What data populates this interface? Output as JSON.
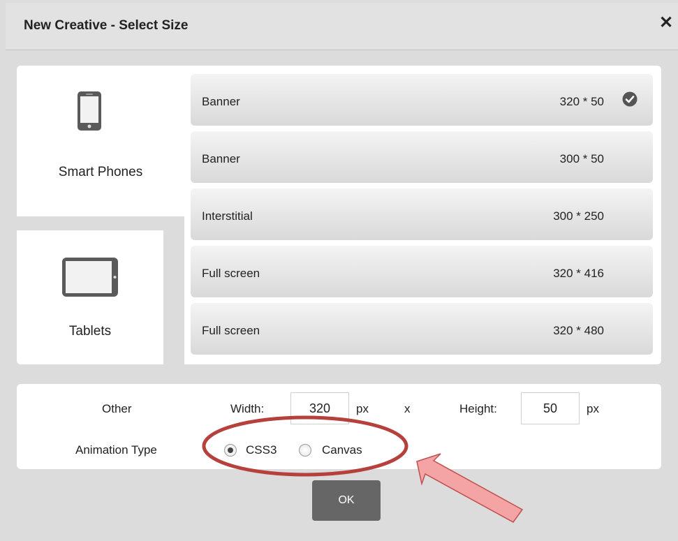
{
  "dialog": {
    "title": "New Creative - Select Size",
    "close_label": "✕"
  },
  "devices": [
    {
      "label": "Smart Phones",
      "icon": "smartphone-icon",
      "selected": true
    },
    {
      "label": "Tablets",
      "icon": "tablet-icon",
      "selected": false
    }
  ],
  "sizes": [
    {
      "name": "Banner",
      "dimensions": "320 * 50",
      "selected": true
    },
    {
      "name": "Banner",
      "dimensions": "300 * 50",
      "selected": false
    },
    {
      "name": "Interstitial",
      "dimensions": "300 * 250",
      "selected": false
    },
    {
      "name": "Full screen",
      "dimensions": "320 * 416",
      "selected": false
    },
    {
      "name": "Full screen",
      "dimensions": "320 * 480",
      "selected": false
    }
  ],
  "other": {
    "label": "Other",
    "width_label": "Width:",
    "width_value": "320",
    "width_unit": "px",
    "times": "x",
    "height_label": "Height:",
    "height_value": "50",
    "height_unit": "px"
  },
  "animation": {
    "label": "Animation Type",
    "options": [
      {
        "label": "CSS3",
        "checked": true
      },
      {
        "label": "Canvas",
        "checked": false
      }
    ]
  },
  "ok_label": "OK",
  "colors": {
    "annotation_ellipse": "#b5403c",
    "annotation_arrow_fill": "#f4a4a4",
    "annotation_arrow_stroke": "#c0504d"
  }
}
